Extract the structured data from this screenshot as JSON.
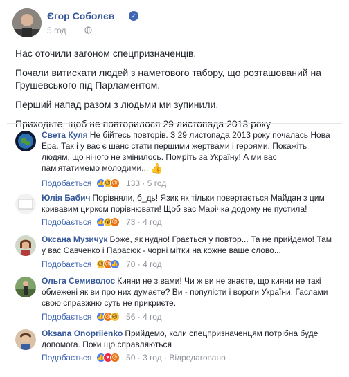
{
  "post": {
    "author": "Єгор Соболєв",
    "time": "5 год",
    "paragraphs": [
      "Нас оточили загоном спецпризначенців.",
      "Почали витискати людей з наметового табору, що розташований на Грушевського під Парламентом.",
      "Перший напад разом з людьми ми зупинили.",
      "Приходьте, щоб не повторилося 29 листопада 2013 року"
    ]
  },
  "labels": {
    "like": "Подобається",
    "dot": "·",
    "edited": "Відредаговано"
  },
  "comments": [
    {
      "name": "Света Куля",
      "text": "Не бійтесь повторів. З 29 листопада 2013 року почалась Нова Ера. Так і у вас є шанс стати першими жертвами і героями. Покажіть людям, що нічого не змінилось. Помріть за Україну! А ми вас пам'ятатимемо молодими...",
      "emoji": "thumbs-up",
      "count": "133",
      "time": "5 год"
    },
    {
      "name": "Юлія Бабич",
      "text": "Порівняли, б_дь! Язик як тільки повертається Майдан з цим кривавим цирком порівнювати! Щоб вас Марічка додому не пустила!",
      "count": "73",
      "time": "4 год"
    },
    {
      "name": "Оксана Музичук",
      "text": "Боже, як нудно! Грається у повтор... Та не прийдемо! Там у вас Савченко і Парасюк - чорні мітки на кожне ваше слово...",
      "count": "70",
      "time": "4 год"
    },
    {
      "name": "Ольга Семиволос",
      "text": "Кияни не з вами! Чи ж ви не знаєте, що кияни не такі обмежені як ви про них думаєте? Ви - популісти і вороги України. Гаслами свою справжню суть не прикриєте.",
      "count": "56",
      "time": "4 год"
    },
    {
      "name": "Oksana Onopriienko",
      "text": "Прийдемо, коли спецпризначенцям потрібна буде допомога. Поки що справляються",
      "count": "50",
      "time": "3 год",
      "edited": true
    }
  ],
  "colors": {
    "link": "#365899",
    "meta": "#90949c",
    "text": "#1d2129",
    "like_blue": "#4a7ef5",
    "angry_orange": "#e9710f",
    "verified": "#4267b2"
  }
}
